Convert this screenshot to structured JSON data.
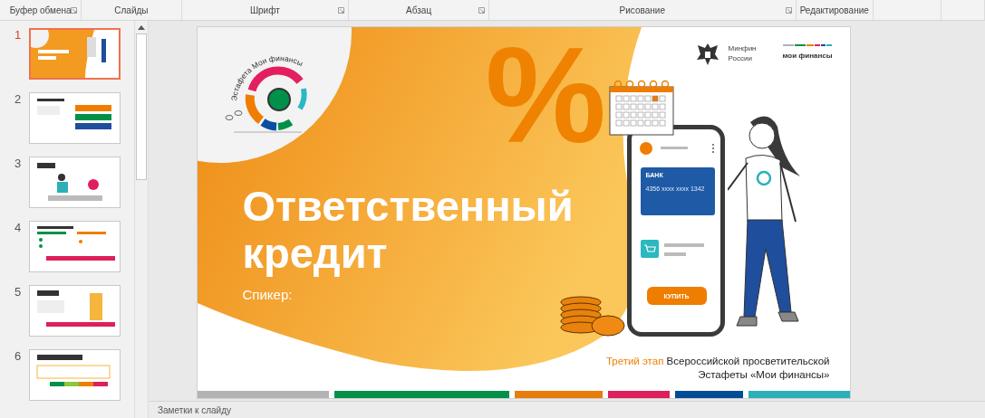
{
  "ribbon_groups": [
    {
      "label": "Буфер обмена",
      "launcher": true
    },
    {
      "label": "Слайды",
      "launcher": false
    },
    {
      "label": "Шрифт",
      "launcher": true
    },
    {
      "label": "Абзац",
      "launcher": true
    },
    {
      "label": "Рисование",
      "launcher": true
    },
    {
      "label": "Редактирование",
      "launcher": false
    }
  ],
  "slides": [
    {
      "number": "1",
      "selected": true
    },
    {
      "number": "2",
      "selected": false
    },
    {
      "number": "3",
      "selected": false
    },
    {
      "number": "4",
      "selected": false
    },
    {
      "number": "5",
      "selected": false
    },
    {
      "number": "6",
      "selected": false
    }
  ],
  "slide": {
    "logo_text": "Эстафета Мои финансы",
    "percent_sign": "%",
    "title": "Ответственный кредит",
    "speaker": "Спикер:",
    "ministry": [
      "Минфин",
      "России"
    ],
    "brand": "мои финансы",
    "card_label": "БАНК",
    "card_number": "4356   xxxx   xxxx   1342",
    "buy_button": "КУПИТЬ",
    "footer_highlight": "Третий этап",
    "footer_text": "Всероссийской просветительской Эстафеты «Мои финансы»",
    "stripes": [
      {
        "color": "#b1b3b4"
      },
      {
        "color": "#00904a"
      },
      {
        "color": "#e87d0b"
      },
      {
        "color": "#de1f5c"
      },
      {
        "color": "#004c97"
      },
      {
        "color": "#2bb0b8"
      }
    ]
  },
  "notes": {
    "placeholder": "Заметки к слайду"
  }
}
